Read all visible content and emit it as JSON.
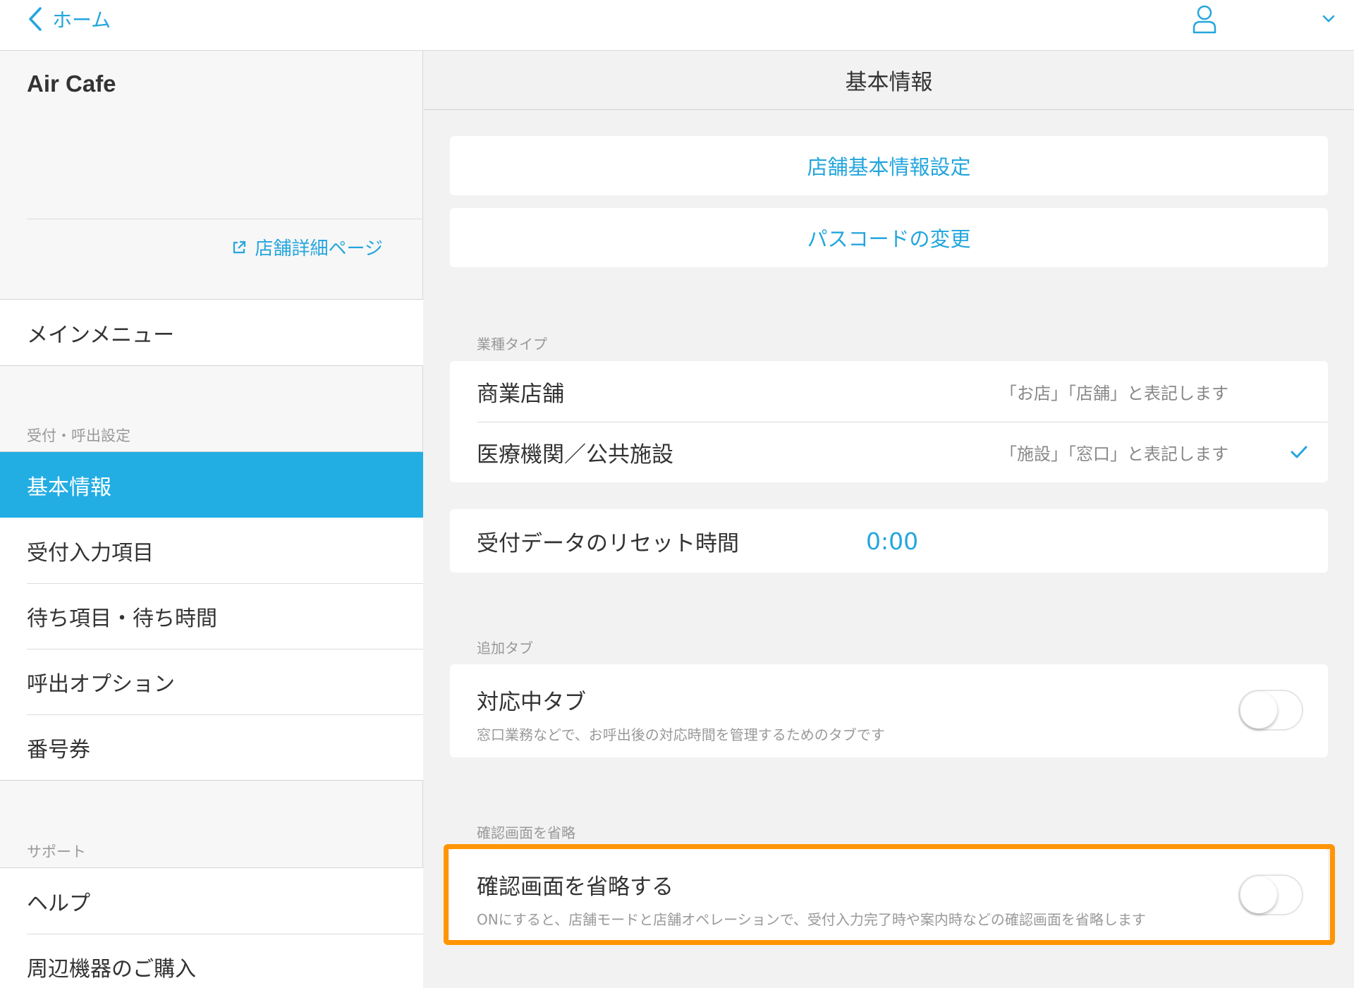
{
  "topbar": {
    "back_label": "ホーム"
  },
  "sidebar": {
    "store_name": "Air Cafe",
    "store_link": "店舗詳細ページ",
    "main_menu": "メインメニュー",
    "section_reception": "受付・呼出設定",
    "items": [
      {
        "label": "基本情報",
        "active": true
      },
      {
        "label": "受付入力項目",
        "active": false
      },
      {
        "label": "待ち項目・待ち時間",
        "active": false
      },
      {
        "label": "呼出オプション",
        "active": false
      },
      {
        "label": "番号券",
        "active": false
      }
    ],
    "section_support": "サポート",
    "support_items": [
      {
        "label": "ヘルプ"
      },
      {
        "label": "周辺機器のご購入"
      }
    ]
  },
  "main": {
    "title": "基本情報",
    "store_settings_link": "店舗基本情報設定",
    "passcode_link": "パスコードの変更",
    "business_type": {
      "label": "業種タイプ",
      "options": [
        {
          "name": "商業店舗",
          "desc": "「お店」「店舗」と表記します",
          "selected": false
        },
        {
          "name": "医療機関／公共施設",
          "desc": "「施設」「窓口」と表記します",
          "selected": true
        }
      ]
    },
    "reset": {
      "label": "受付データのリセット時間",
      "value": "0:00"
    },
    "extra_tab": {
      "label": "追加タブ",
      "title": "対応中タブ",
      "subtitle": "窓口業務などで、お呼出後の対応時間を管理するためのタブです",
      "on": false
    },
    "skip_confirm": {
      "label": "確認画面を省略",
      "title": "確認画面を省略する",
      "subtitle": "ONにすると、店舗モードと店舗オペレーションで、受付入力完了時や案内時などの確認画面を省略します",
      "on": false
    }
  },
  "colors": {
    "accent": "#24a6dd",
    "active_bg": "#22ade3",
    "highlight": "#ff9500"
  }
}
